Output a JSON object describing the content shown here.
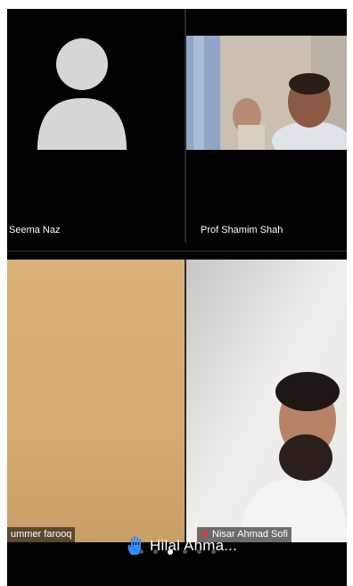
{
  "participants": [
    {
      "name": "Seema Naz",
      "video": "off",
      "avatar_icon": "person-placeholder-icon"
    },
    {
      "name": "Prof Shamim Shah",
      "video": "on"
    },
    {
      "name": "ummer farooq",
      "video": "on"
    },
    {
      "name": "Nisar Ahmad Sofi",
      "video": "on",
      "muted_icon": "mic-muted-icon"
    }
  ],
  "raised_hand": {
    "icon": "raised-hand-icon",
    "name": "Hilal Ahma...",
    "color": "#2d8cff"
  },
  "pager": {
    "total": 6,
    "current": 3
  },
  "colors": {
    "background": "#000000",
    "avatar": "#d6d6d6",
    "active_dot": "#ffffff",
    "inactive_dot": "#555555"
  }
}
